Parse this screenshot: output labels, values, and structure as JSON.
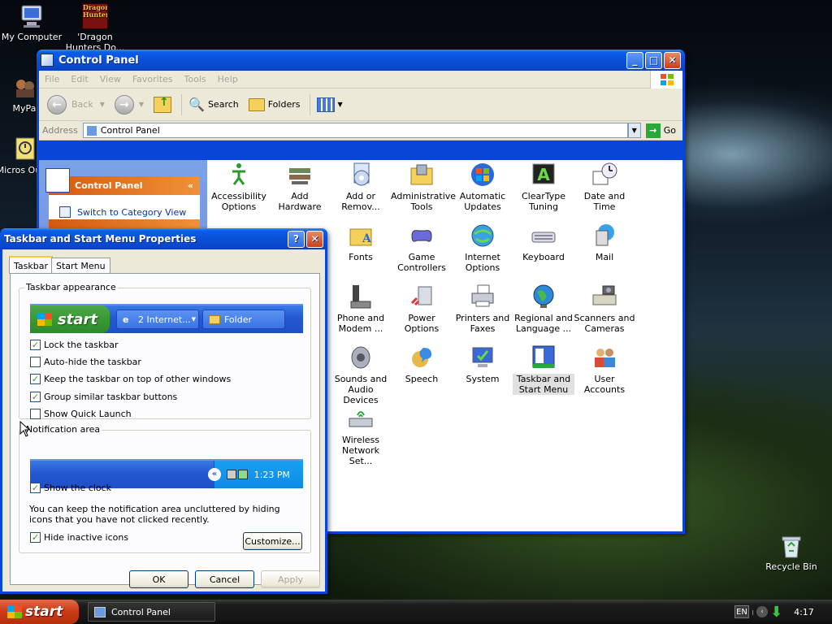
{
  "desktop": {
    "icons": [
      {
        "label": "My Computer"
      },
      {
        "label": "'Dragon Hunters Do..."
      },
      {
        "label": "MyPa"
      },
      {
        "label": "Micros Outlo"
      },
      {
        "label": "Recycle Bin"
      }
    ],
    "dragon_logo_text": "Dragon Hunters"
  },
  "control_panel": {
    "title": "Control Panel",
    "menu": [
      "File",
      "Edit",
      "View",
      "Favorites",
      "Tools",
      "Help"
    ],
    "toolbar": {
      "back": "Back",
      "search": "Search",
      "folders": "Folders"
    },
    "address_label": "Address",
    "address_value": "Control Panel",
    "go_label": "Go",
    "sidebar": {
      "header": "Control Panel",
      "link": "Switch to Category View"
    },
    "items": [
      {
        "label": "Accessibility Options"
      },
      {
        "label": "Add Hardware"
      },
      {
        "label": "Add or Remov..."
      },
      {
        "label": "Administrative Tools"
      },
      {
        "label": "Automatic Updates"
      },
      {
        "label": "ClearType Tuning"
      },
      {
        "label": "Date and Time"
      },
      {
        "label": "Fonts"
      },
      {
        "label": "Game Controllers"
      },
      {
        "label": "Internet Options"
      },
      {
        "label": "Keyboard"
      },
      {
        "label": "Mail"
      },
      {
        "label": "Phone and Modem ..."
      },
      {
        "label": "Power Options"
      },
      {
        "label": "Printers and Faxes"
      },
      {
        "label": "Regional and Language ..."
      },
      {
        "label": "Scanners and Cameras"
      },
      {
        "label": "Sounds and Audio Devices"
      },
      {
        "label": "Speech"
      },
      {
        "label": "System"
      },
      {
        "label": "Taskbar and Start Menu"
      },
      {
        "label": "User Accounts"
      },
      {
        "label": "Wireless Network Set..."
      }
    ]
  },
  "dialog": {
    "title": "Taskbar and Start Menu Properties",
    "tabs": [
      "Taskbar",
      "Start Menu"
    ],
    "appearance_group": "Taskbar appearance",
    "preview": {
      "start": "start",
      "task1": "2 Internet...",
      "task2": "Folder"
    },
    "checks": [
      {
        "label": "Lock the taskbar",
        "checked": true
      },
      {
        "label": "Auto-hide the taskbar",
        "checked": false
      },
      {
        "label": "Keep the taskbar on top of other windows",
        "checked": true
      },
      {
        "label": "Group similar taskbar buttons",
        "checked": true
      },
      {
        "label": "Show Quick Launch",
        "checked": false
      }
    ],
    "notification_group": "Notification area",
    "notif_clock": "1:23 PM",
    "show_clock": {
      "label": "Show the clock",
      "checked": true
    },
    "notif_text": "You can keep the notification area uncluttered by hiding icons that you have not clicked recently.",
    "hide_inactive": {
      "label": "Hide inactive icons",
      "checked": true
    },
    "customize": "Customize...",
    "ok": "OK",
    "cancel": "Cancel",
    "apply": "Apply"
  },
  "taskbar": {
    "start": "start",
    "task": "Control Panel",
    "lang": "EN",
    "clock": "4:17"
  }
}
